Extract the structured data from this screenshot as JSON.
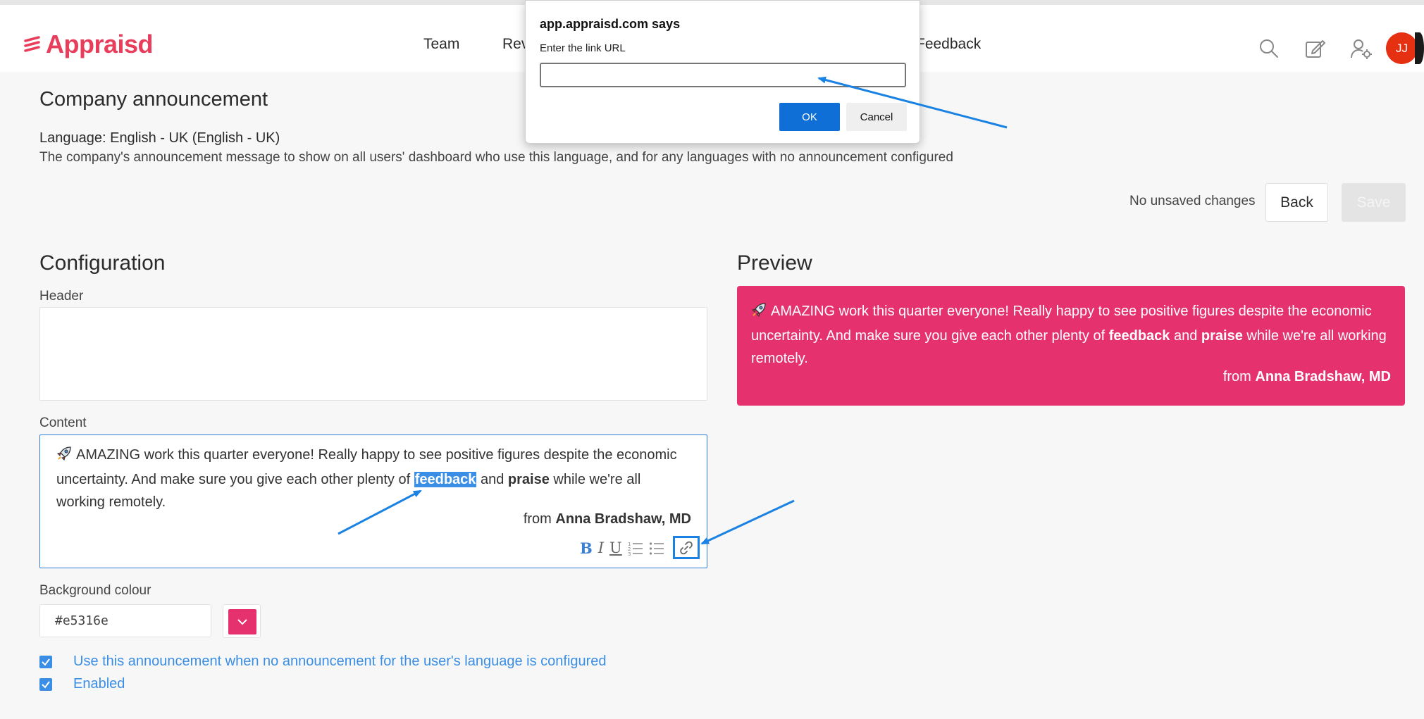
{
  "brand": {
    "name": "Appraisd",
    "color": "#e83e5c"
  },
  "nav": {
    "team": "Team",
    "reviews_partial": "Rev",
    "feedback_partial": "Feedback"
  },
  "header_icons": [
    "search-icon",
    "compose-icon",
    "user-settings-icon"
  ],
  "avatar": {
    "initials": "JJ",
    "color": "#e53012"
  },
  "page": {
    "title": "Company announcement",
    "language": "Language: English - UK (English - UK)",
    "description": "The company's announcement message to show on all users' dashboard who use this language, and for any languages with no announcement configured",
    "status": "No unsaved changes",
    "back_label": "Back",
    "save_label": "Save"
  },
  "config": {
    "title": "Configuration",
    "header_label": "Header",
    "header_value": "",
    "content_label": "Content",
    "content": {
      "before_selection": "AMAZING work this quarter everyone! Really happy to see positive figures despite the economic uncertainty. And make sure you give each other plenty of ",
      "selected_word": "feedback",
      "middle": " and ",
      "bold_word": "praise",
      "after": " while we're all working remotely.",
      "from_prefix": "from ",
      "from_name": "Anna Bradshaw, MD"
    },
    "toolbar": {
      "bold": "B",
      "italic": "I",
      "underline": "U"
    },
    "bg_label": "Background colour",
    "bg_value": "#e5316e",
    "checkbox_fallback": "Use this announcement when no announcement for the user's language is configured",
    "checkbox_enabled": "Enabled",
    "fallback_checked": true,
    "enabled_checked": true
  },
  "preview": {
    "title": "Preview",
    "bg_color": "#e5316e",
    "text_before": "AMAZING work this quarter everyone! Really happy to see positive figures despite the economic uncertainty. And make sure you give each other plenty of ",
    "bold1": "feedback",
    "middle": " and ",
    "bold2": "praise",
    "after": " while we're all working remotely.",
    "from_prefix": "from ",
    "from_name": "Anna Bradshaw, MD"
  },
  "dialog": {
    "title": "app.appraisd.com says",
    "prompt": "Enter the link URL",
    "input_value": "",
    "ok_label": "OK",
    "cancel_label": "Cancel"
  },
  "annotation_color": "#1a82e2"
}
